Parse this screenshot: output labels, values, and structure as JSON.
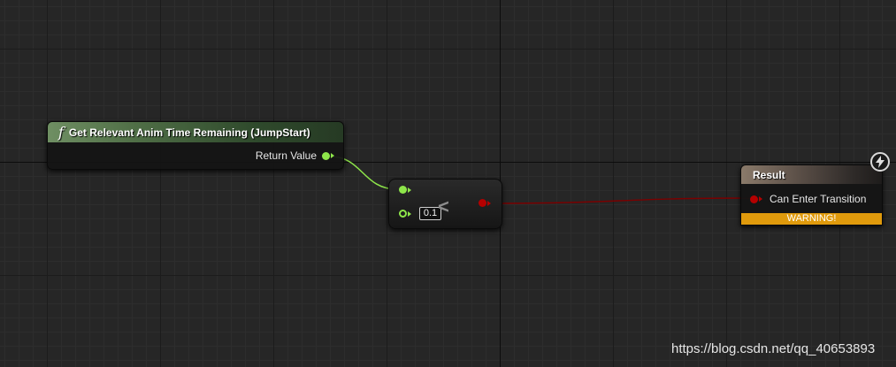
{
  "graph": {
    "function_node": {
      "title": "Get Relevant Anim Time Remaining (JumpStart)",
      "output_pin_label": "Return Value",
      "icon": "function-icon",
      "header_color": "#4f6e46"
    },
    "compare_node": {
      "operator": "<",
      "input_b_value": "0.1"
    },
    "result_node": {
      "title": "Result",
      "input_pin_label": "Can Enter Transition",
      "warning_text": "WARNING!",
      "warning_color": "#e09a0c",
      "icon": "lightning-bolt-icon"
    },
    "colors": {
      "float_pin": "#8ee64a",
      "bool_pin": "#b50000"
    }
  },
  "watermark": "https://blog.csdn.net/qq_40653893"
}
